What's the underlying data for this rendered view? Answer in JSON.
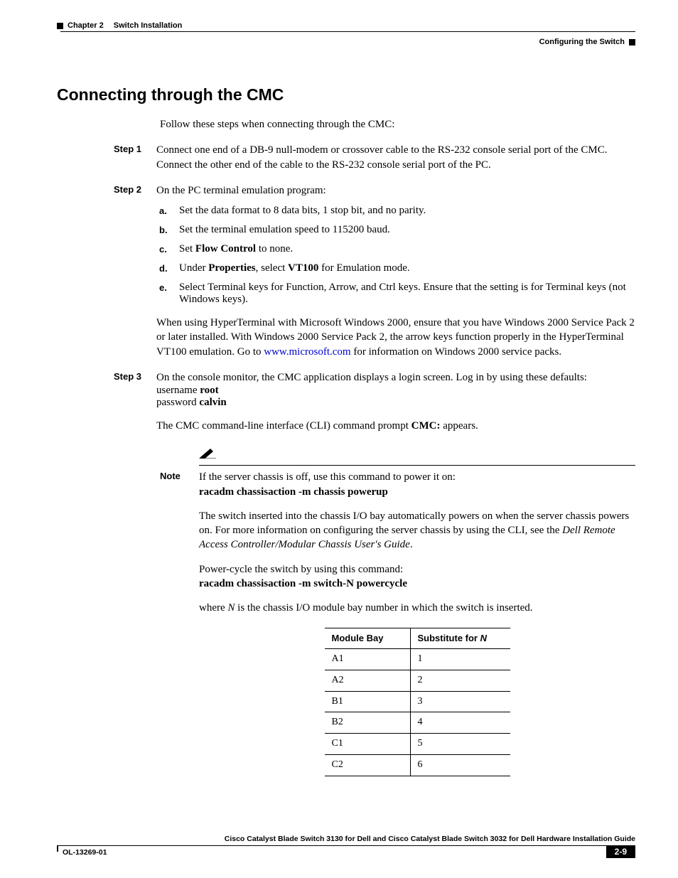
{
  "header": {
    "chapter": "Chapter 2",
    "title": "Switch Installation",
    "subtitle": "Configuring the Switch"
  },
  "section": {
    "title": "Connecting through the CMC",
    "intro": "Follow these steps when connecting through the CMC:"
  },
  "steps": {
    "s1": {
      "label": "Step 1",
      "text": "Connect one end of a DB-9 null-modem or crossover cable to the RS-232 console serial port of the CMC. Connect the other end of the cable to the RS-232 console serial port of the PC."
    },
    "s2": {
      "label": "Step 2",
      "intro": "On the PC terminal emulation program:",
      "a": {
        "label": "a.",
        "text": "Set the data format to 8 data bits, 1 stop bit, and no parity."
      },
      "b": {
        "label": "b.",
        "text": "Set the terminal emulation speed to 115200 baud."
      },
      "c": {
        "label": "c.",
        "pre": "Set ",
        "bold": "Flow Control",
        "post": " to none."
      },
      "d": {
        "label": "d.",
        "pre": "Under ",
        "bold1": "Properties",
        "mid": ", select ",
        "bold2": "VT100",
        "post": " for Emulation mode."
      },
      "e": {
        "label": "e.",
        "text": "Select Terminal keys for Function, Arrow, and Ctrl keys. Ensure that the setting is for Terminal keys (not Windows keys)."
      },
      "closing_pre": "When using HyperTerminal with Microsoft Windows 2000, ensure that you have Windows 2000 Service Pack 2 or later installed. With Windows 2000 Service Pack 2, the arrow keys function properly in the HyperTerminal VT100 emulation. Go to ",
      "closing_link": "www.microsoft.com",
      "closing_post": " for information on Windows 2000 service packs."
    },
    "s3": {
      "label": "Step 3",
      "line1": "On the console monitor, the CMC application displays a login screen. Log in by using these defaults:",
      "line2_pre": "username ",
      "line2_bold": "root",
      "line3_pre": "password ",
      "line3_bold": "calvin",
      "line4_pre": "The CMC command-line interface (CLI) command prompt ",
      "line4_bold": "CMC:",
      "line4_post": " appears."
    }
  },
  "note": {
    "label": "Note",
    "l1": "If the server chassis is off, use this command to power it on:",
    "l2": "racadm chassisaction -m chassis powerup",
    "p2_pre": "The switch inserted into the chassis I/O bay automatically powers on when the server chassis powers on. For more information on configuring the server chassis by using the CLI, see the ",
    "p2_ital": "Dell Remote Access Controller/Modular Chassis User's Guide",
    "p2_post": ".",
    "p3": "Power-cycle the switch by using this command:",
    "p3_cmd": "racadm chassisaction -m switch-N powercycle",
    "p4_pre": "where ",
    "p4_ital": "N",
    "p4_post": " is the chassis I/O module bay number in which the switch is inserted."
  },
  "table": {
    "h1": "Module Bay",
    "h2_pre": "Substitute for ",
    "h2_ital": "N",
    "rows": [
      {
        "c1": "A1",
        "c2": "1"
      },
      {
        "c1": "A2",
        "c2": "2"
      },
      {
        "c1": "B1",
        "c2": "3"
      },
      {
        "c1": "B2",
        "c2": "4"
      },
      {
        "c1": "C1",
        "c2": "5"
      },
      {
        "c1": "C2",
        "c2": "6"
      }
    ]
  },
  "footer": {
    "title": "Cisco Catalyst Blade Switch 3130 for Dell and Cisco Catalyst Blade Switch 3032 for Dell Hardware Installation Guide",
    "doc": "OL-13269-01",
    "page": "2-9"
  }
}
